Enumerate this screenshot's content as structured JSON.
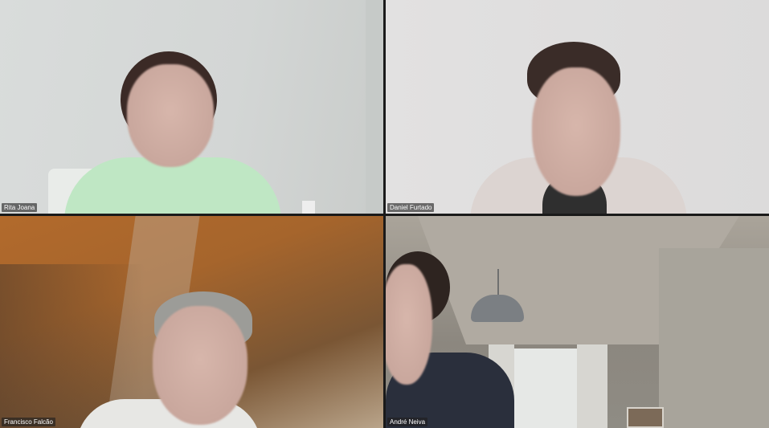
{
  "participants": [
    {
      "name": "Rita Joana"
    },
    {
      "name": "Daniel Furtado"
    },
    {
      "name": "Francisco Falcão"
    },
    {
      "name": "André Neiva"
    }
  ],
  "colors": {
    "label_bg": "#1e1e1e",
    "label_text": "#ffffff",
    "divider": "#1a1a1a"
  }
}
